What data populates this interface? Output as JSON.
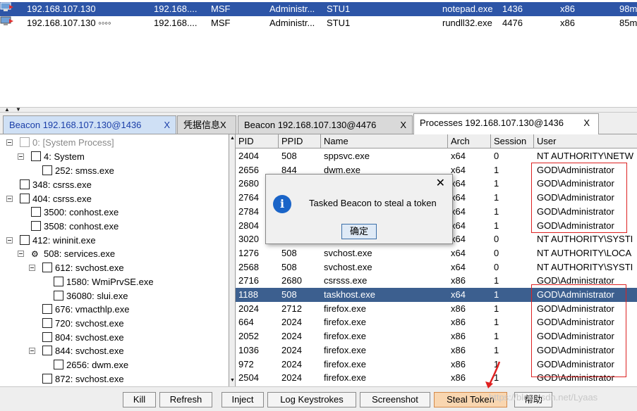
{
  "sessions": [
    {
      "external": "192.168.107.130",
      "internal": "192.168....",
      "listener": "MSF",
      "user": "Administr...",
      "computer": "STU1",
      "process": "notepad.exe",
      "pid": "1436",
      "arch": "x86",
      "last": "98m"
    },
    {
      "external": "192.168.107.130 ◦◦◦◦",
      "internal": "192.168....",
      "listener": "MSF",
      "user": "Administr...",
      "computer": "STU1",
      "process": "rundll32.exe",
      "pid": "4476",
      "arch": "x86",
      "last": "85m"
    }
  ],
  "tabs": [
    {
      "label": "Beacon 192.168.107.130@1436",
      "close": "X"
    },
    {
      "label": "凭据信息",
      "close": "X"
    },
    {
      "label": "Beacon 192.168.107.130@4476",
      "close": "X"
    },
    {
      "label": "Processes 192.168.107.130@1436",
      "close": "X"
    }
  ],
  "tree": [
    "0: [System Process]",
    "4: System",
    "252: smss.exe",
    "348: csrss.exe",
    "404: csrss.exe",
    "3500: conhost.exe",
    "3508: conhost.exe",
    "412: wininit.exe",
    "508: services.exe",
    "612: svchost.exe",
    "1580: WmiPrvSE.exe",
    "36080: slui.exe",
    "676: vmacthlp.exe",
    "720: svchost.exe",
    "804: svchost.exe",
    "844: svchost.exe",
    "2656: dwm.exe",
    "872: svchost.exe"
  ],
  "process_table": {
    "headers": [
      "PID",
      "PPID",
      "Name",
      "Arch",
      "Session",
      "User"
    ],
    "rows": [
      [
        "2404",
        "508",
        "sppsvc.exe",
        "x64",
        "0",
        "NT AUTHORITY\\NETW"
      ],
      [
        "2656",
        "844",
        "dwm.exe",
        "x64",
        "1",
        "GOD\\Administrator"
      ],
      [
        "2680",
        "",
        "",
        "x64",
        "1",
        "GOD\\Administrator"
      ],
      [
        "2764",
        "",
        "",
        "x64",
        "1",
        "GOD\\Administrator"
      ],
      [
        "2784",
        "",
        "",
        "x64",
        "1",
        "GOD\\Administrator"
      ],
      [
        "2804",
        "",
        "",
        "x64",
        "1",
        "GOD\\Administrator"
      ],
      [
        "3020",
        "",
        "",
        "x64",
        "0",
        "NT AUTHORITY\\SYSTI"
      ],
      [
        "1276",
        "508",
        "svchost.exe",
        "x64",
        "0",
        "NT AUTHORITY\\LOCA"
      ],
      [
        "2568",
        "508",
        "svchost.exe",
        "x64",
        "0",
        "NT AUTHORITY\\SYSTI"
      ],
      [
        "2716",
        "2680",
        "csrsss.exe",
        "x86",
        "1",
        "GOD\\Administrator"
      ],
      [
        "1188",
        "508",
        "taskhost.exe",
        "x64",
        "1",
        "GOD\\Administrator"
      ],
      [
        "2024",
        "2712",
        "firefox.exe",
        "x86",
        "1",
        "GOD\\Administrator"
      ],
      [
        "664",
        "2024",
        "firefox.exe",
        "x86",
        "1",
        "GOD\\Administrator"
      ],
      [
        "2052",
        "2024",
        "firefox.exe",
        "x86",
        "1",
        "GOD\\Administrator"
      ],
      [
        "1036",
        "2024",
        "firefox.exe",
        "x86",
        "1",
        "GOD\\Administrator"
      ],
      [
        "972",
        "2024",
        "firefox.exe",
        "x86",
        "1",
        "GOD\\Administrator"
      ],
      [
        "2504",
        "2024",
        "firefox.exe",
        "x86",
        "1",
        "GOD\\Administrator"
      ]
    ]
  },
  "dialog": {
    "message": "Tasked Beacon to steal a token",
    "ok_label": "确定",
    "close": "✕"
  },
  "buttons": [
    "Kill",
    "Refresh",
    "Inject",
    "Log Keystrokes",
    "Screenshot",
    "Steal Token",
    "帮助"
  ],
  "watermark": "https://blog.csdn.net/Lyaas",
  "colors": {
    "accent": "#2d55a7",
    "highlight_box": "#dd2222",
    "steal_token": "#f9d6b0"
  }
}
